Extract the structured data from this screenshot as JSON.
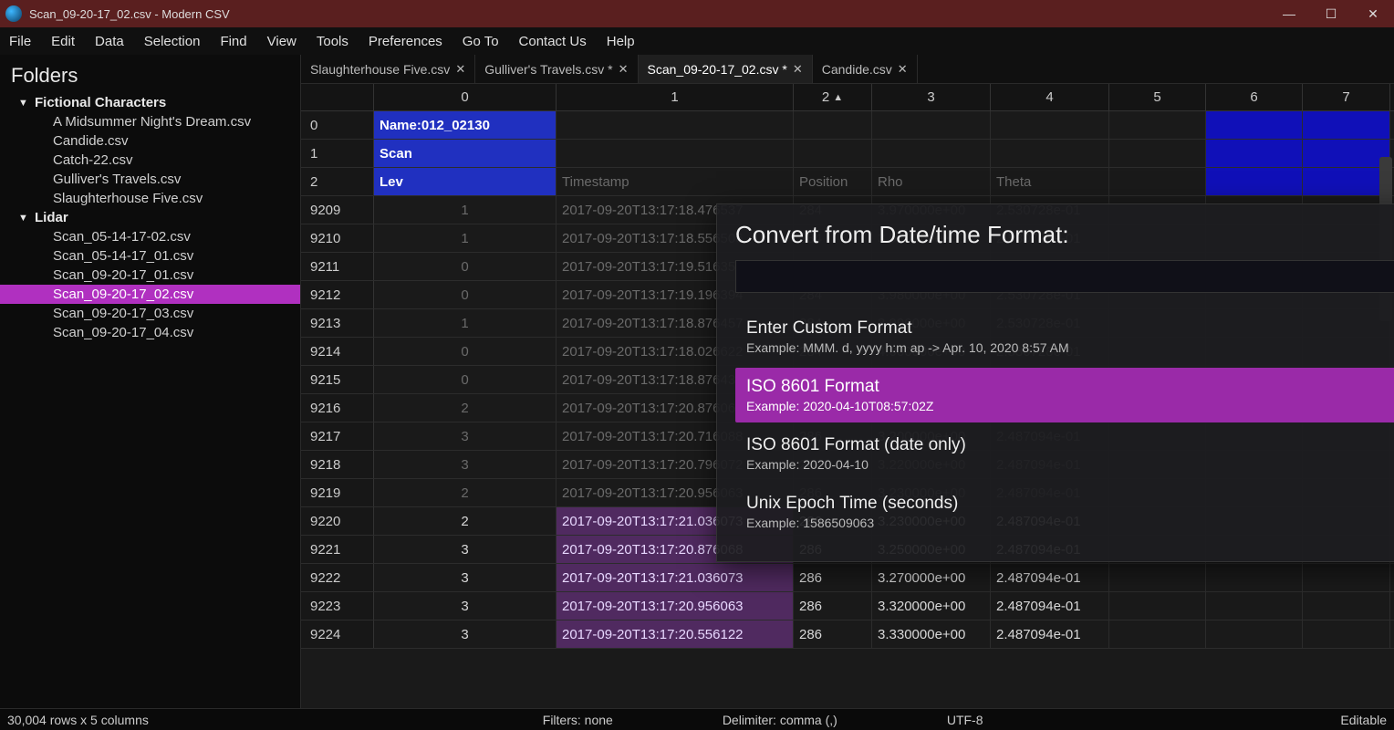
{
  "window": {
    "title": "Scan_09-20-17_02.csv - Modern CSV",
    "min": "—",
    "max": "☐",
    "close": "✕"
  },
  "menu": [
    "File",
    "Edit",
    "Data",
    "Selection",
    "Find",
    "View",
    "Tools",
    "Preferences",
    "Go To",
    "Contact Us",
    "Help"
  ],
  "sidebar": {
    "title": "Folders",
    "folders": [
      {
        "name": "Fictional Characters",
        "items": [
          "A Midsummer Night's Dream.csv",
          "Candide.csv",
          "Catch-22.csv",
          "Gulliver's Travels.csv",
          "Slaughterhouse Five.csv"
        ]
      },
      {
        "name": "Lidar",
        "items": [
          "Scan_05-14-17-02.csv",
          "Scan_05-14-17_01.csv",
          "Scan_09-20-17_01.csv",
          "Scan_09-20-17_02.csv",
          "Scan_09-20-17_03.csv",
          "Scan_09-20-17_04.csv"
        ]
      }
    ],
    "selected": "Scan_09-20-17_02.csv"
  },
  "tabs": [
    {
      "label": "Slaughterhouse Five.csv",
      "dirty": false,
      "active": false
    },
    {
      "label": "Gulliver's Travels.csv",
      "dirty": true,
      "active": false
    },
    {
      "label": "Scan_09-20-17_02.csv",
      "dirty": true,
      "active": true
    },
    {
      "label": "Candide.csv",
      "dirty": false,
      "active": false
    }
  ],
  "columns": [
    "0",
    "1",
    "2",
    "3",
    "4",
    "5",
    "6",
    "7"
  ],
  "sortedColumn": 2,
  "headerRows": [
    {
      "num": "0",
      "c0": "Name:012_02130"
    },
    {
      "num": "1",
      "c0": "Scan"
    },
    {
      "num": "2",
      "c0": "Lev",
      "c1": "Timestamp",
      "c2": "Position",
      "c3": "Rho",
      "c4": "Theta"
    }
  ],
  "dataRows": [
    {
      "num": "9209",
      "c0": "1",
      "c1": "2017-09-20T13:17:18.476537",
      "c2": "284",
      "c3": "3.970000e+00",
      "c4": "2.530728e-01"
    },
    {
      "num": "9210",
      "c0": "1",
      "c1": "2017-09-20T13:17:18.556506",
      "c2": "284",
      "c3": "3.970000e+00",
      "c4": "2.530728e-01"
    },
    {
      "num": "9211",
      "c0": "0",
      "c1": "2017-09-20T13:17:19.516359",
      "c2": "284",
      "c3": "3.970000e+00",
      "c4": "2.530728e-01"
    },
    {
      "num": "9212",
      "c0": "0",
      "c1": "2017-09-20T13:17:19.196394",
      "c2": "284",
      "c3": "3.980000e+00",
      "c4": "2.530728e-01"
    },
    {
      "num": "9213",
      "c0": "1",
      "c1": "2017-09-20T13:17:18.876457",
      "c2": "284",
      "c3": "3.990000e+00",
      "c4": "2.530728e-01"
    },
    {
      "num": "9214",
      "c0": "0",
      "c1": "2017-09-20T13:17:18.026622",
      "c2": "284",
      "c3": "4.000000e+00",
      "c4": "2.530728e-01"
    },
    {
      "num": "9215",
      "c0": "0",
      "c1": "2017-09-20T13:17:18.876437",
      "c2": "284",
      "c3": "4.000000e+00",
      "c4": "2.530728e-01"
    },
    {
      "num": "9216",
      "c0": "2",
      "c1": "2017-09-20T13:17:20.876068",
      "c2": "286",
      "c3": "3.170000e+00",
      "c4": "2.487094e-01"
    },
    {
      "num": "9217",
      "c0": "3",
      "c1": "2017-09-20T13:17:20.716088",
      "c2": "286",
      "c3": "3.200000e+00",
      "c4": "2.487094e-01"
    },
    {
      "num": "9218",
      "c0": "3",
      "c1": "2017-09-20T13:17:20.796072",
      "c2": "286",
      "c3": "3.220000e+00",
      "c4": "2.487094e-01"
    },
    {
      "num": "9219",
      "c0": "2",
      "c1": "2017-09-20T13:17:20.956063",
      "c2": "286",
      "c3": "3.230000e+00",
      "c4": "2.487094e-01"
    },
    {
      "num": "9220",
      "c0": "2",
      "c1": "2017-09-20T13:17:21.036073",
      "c2": "286",
      "c3": "3.230000e+00",
      "c4": "2.487094e-01"
    },
    {
      "num": "9221",
      "c0": "3",
      "c1": "2017-09-20T13:17:20.876068",
      "c2": "286",
      "c3": "3.250000e+00",
      "c4": "2.487094e-01"
    },
    {
      "num": "9222",
      "c0": "3",
      "c1": "2017-09-20T13:17:21.036073",
      "c2": "286",
      "c3": "3.270000e+00",
      "c4": "2.487094e-01"
    },
    {
      "num": "9223",
      "c0": "3",
      "c1": "2017-09-20T13:17:20.956063",
      "c2": "286",
      "c3": "3.320000e+00",
      "c4": "2.487094e-01"
    },
    {
      "num": "9224",
      "c0": "3",
      "c1": "2017-09-20T13:17:20.556122",
      "c2": "286",
      "c3": "3.330000e+00",
      "c4": "2.487094e-01"
    }
  ],
  "dimThreshold": "9220",
  "dialog": {
    "title": "Convert from Date/time Format:",
    "input": "",
    "options": [
      {
        "title": "Enter Custom Format",
        "sub": "Example: MMM. d, yyyy h:m ap -> Apr. 10, 2020 8:57 AM"
      },
      {
        "title": "ISO 8601 Format",
        "sub": "Example: 2020-04-10T08:57:02Z",
        "selected": true
      },
      {
        "title": "ISO 8601 Format (date only)",
        "sub": "Example: 2020-04-10"
      },
      {
        "title": "Unix Epoch Time (seconds)",
        "sub": "Example: 1586509063"
      }
    ]
  },
  "status": {
    "rows": "30,004 rows x 5 columns",
    "filters": "Filters: none",
    "delim": "Delimiter: comma (,)",
    "enc": "UTF-8",
    "edit": "Editable"
  }
}
